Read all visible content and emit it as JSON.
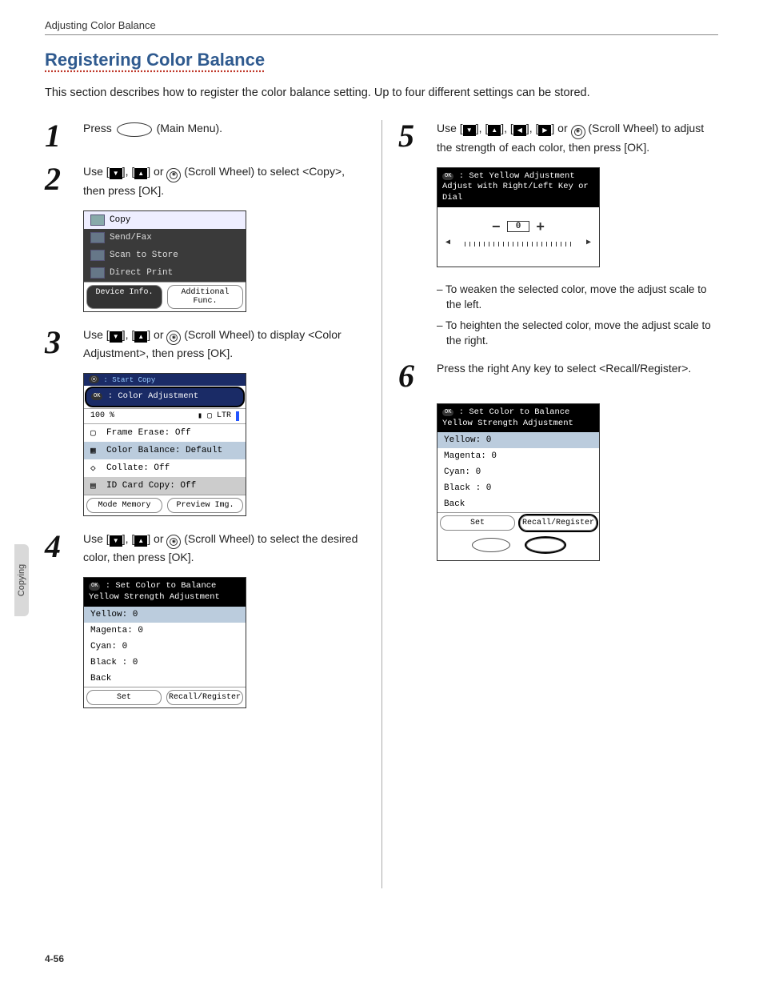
{
  "page": {
    "running_head": "Adjusting Color Balance",
    "section_title": "Registering Color Balance",
    "intro": "This section describes how to register the color balance setting. Up to four different settings can be stored.",
    "page_number": "4-56",
    "side_tab": "Copying"
  },
  "glyphs": {
    "down": "▼",
    "up": "▲",
    "left": "◀",
    "right": "▶"
  },
  "steps": {
    "s1": {
      "num": "1",
      "text_a": "Press ",
      "text_b": " (Main Menu)."
    },
    "s2": {
      "num": "2",
      "text": "Use [▼], [▲] or ⦿ (Scroll Wheel) to select <Copy>, then press [OK]."
    },
    "s3": {
      "num": "3",
      "text": "Use [▼], [▲] or ⦿ (Scroll Wheel) to display <Color Adjustment>, then press [OK]."
    },
    "s4": {
      "num": "4",
      "text": "Use [▼], [▲] or ⦿ (Scroll Wheel) to select the desired color, then press [OK]."
    },
    "s5": {
      "num": "5",
      "text": "Use [▼], [▲], [◀], [▶] or ⦿ (Scroll Wheel) to adjust the strength of each color, then press [OK]."
    },
    "s6": {
      "num": "6",
      "text": "Press the right Any key to select <Recall/Register>."
    }
  },
  "dev_a": {
    "copy": "Copy",
    "sendfax": "Send/Fax",
    "scan": "Scan to Store",
    "direct": "Direct Print",
    "btn_left": "Device Info.",
    "btn_right": "Additional Func."
  },
  "dev_b": {
    "pre": ": Start Copy",
    "title": ": Color Adjustment",
    "zoom": "100 %",
    "paper": "LTR",
    "r1": "Frame Erase: Off",
    "r2": "Color Balance: Default",
    "r3": "Collate: Off",
    "r4": "ID Card Copy: Off",
    "btn_left": "Mode Memory",
    "btn_right": "Preview Img."
  },
  "dev_c": {
    "title1": ": Set Color to Balance",
    "title2": "Yellow Strength Adjustment",
    "r1": "Yellow: 0",
    "r2": "Magenta: 0",
    "r3": "Cyan: 0",
    "r4": "Black : 0",
    "r5": "Back",
    "btn_left": "Set",
    "btn_right": "Recall/Register"
  },
  "dev_d": {
    "title1": ": Set Yellow Adjustment",
    "title2": "Adjust with Right/Left Key or Dial",
    "value": "0",
    "minus": "−",
    "plus": "+"
  },
  "notes": {
    "b1": "To weaken the selected color, move the adjust scale to the left.",
    "b2": "To heighten the selected color, move the adjust scale to the right."
  }
}
